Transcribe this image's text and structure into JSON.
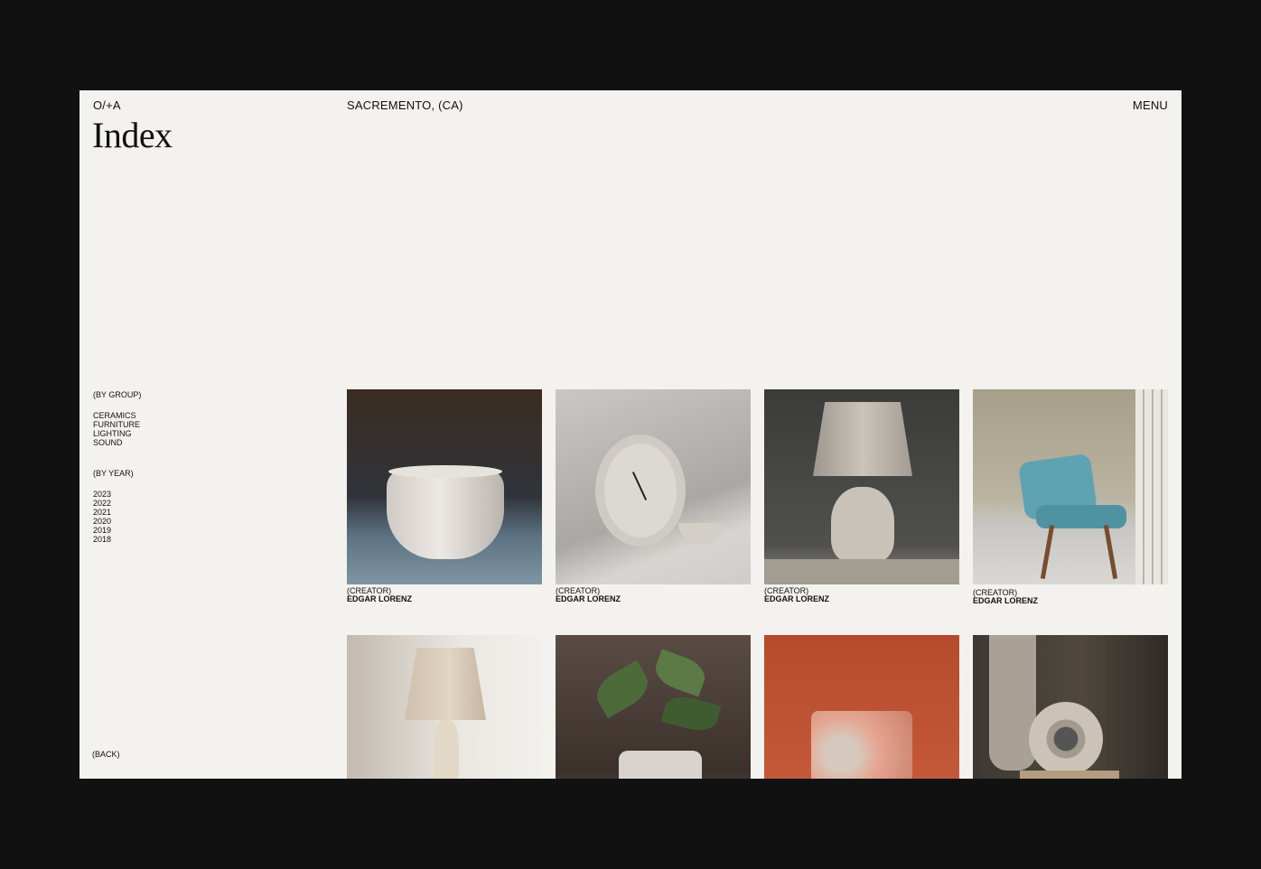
{
  "header": {
    "brand": "O/+A",
    "location": "SACREMENTO, (CA)",
    "menu": "MENU",
    "title": "Index"
  },
  "filters": {
    "group_heading": "(BY GROUP)",
    "groups": [
      "CERAMICS",
      "FURNITURE",
      "LIGHTING",
      "SOUND"
    ],
    "year_heading": "(BY YEAR)",
    "years": [
      "2023",
      "2022",
      "2021",
      "2020",
      "2019",
      "2018"
    ]
  },
  "back_label": "(BACK)",
  "items": [
    {
      "label": "(CREATOR)",
      "creator": "EDGAR LORENZ",
      "image": "ceramic-bowl"
    },
    {
      "label": "(CREATOR)",
      "creator": "EDGAR LORENZ",
      "image": "stone-clock"
    },
    {
      "label": "(CREATOR)",
      "creator": "EDGAR LORENZ",
      "image": "table-lamp"
    },
    {
      "label": "(CREATOR)",
      "creator": "EDGAR LORENZ",
      "image": "lounge-chair"
    },
    {
      "image": "beige-lamp"
    },
    {
      "image": "potted-plant"
    },
    {
      "image": "speckled-cup"
    },
    {
      "image": "speaker"
    }
  ]
}
